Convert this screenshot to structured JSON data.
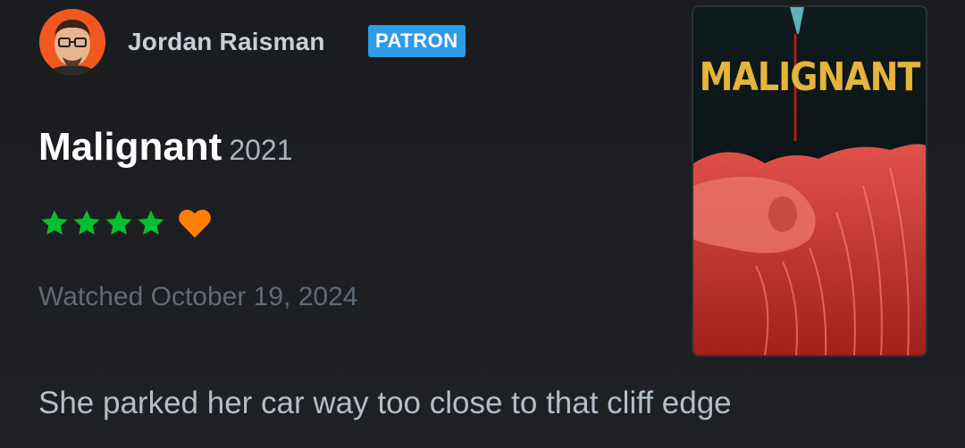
{
  "review": {
    "user": {
      "name": "Jordan Raisman",
      "badge": "PATRON"
    },
    "film": {
      "title": "Malignant",
      "year": "2021",
      "poster_title": "MALIGNANT"
    },
    "rating": {
      "stars": 4,
      "max_stars": 5,
      "liked": true
    },
    "watched_text": "Watched October 19, 2024",
    "text": "She parked her car way too close to that cliff edge"
  },
  "colors": {
    "background": "#1c1e22",
    "star": "#00c030",
    "heart": "#ff8000",
    "badge": "#2e9be6",
    "avatar_bg": "#f0581f"
  }
}
